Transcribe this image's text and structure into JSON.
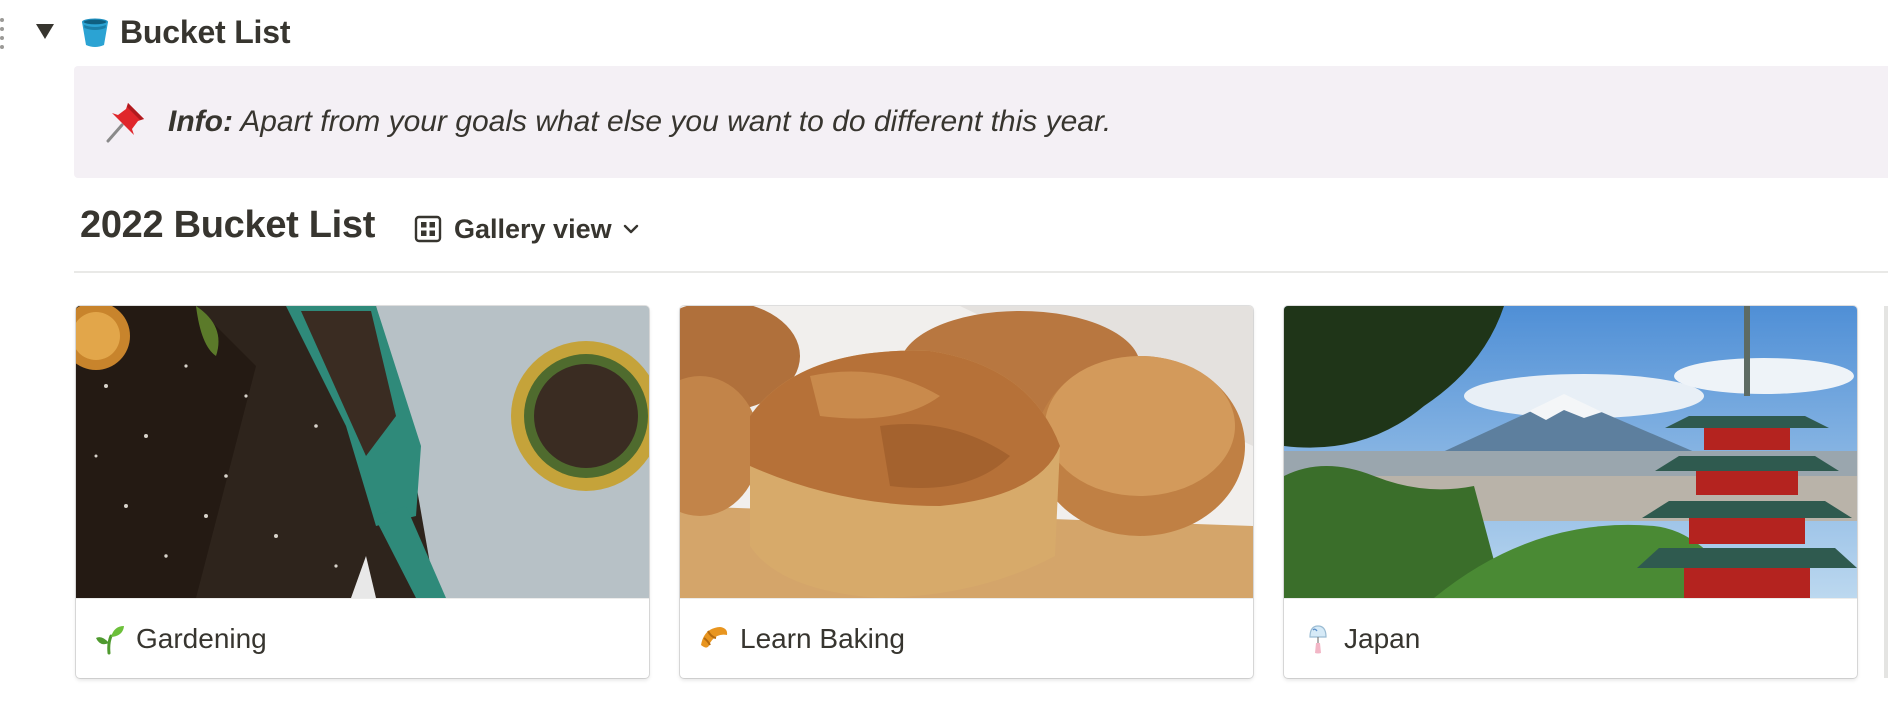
{
  "toggle": {
    "title": "Bucket List",
    "icon": "bucket-icon",
    "expanded": true
  },
  "callout": {
    "icon": "pushpin-icon",
    "label": "Info:",
    "text": " Apart from your goals what else you want to do different this year."
  },
  "database": {
    "title": "2022 Bucket List",
    "view": {
      "icon": "gallery-grid-icon",
      "label": "Gallery view",
      "dropdown_icon": "chevron-down-icon"
    },
    "cards": [
      {
        "title": "Gardening",
        "icon": "seedling-icon",
        "cover": "garden soil, trowel and plant pot"
      },
      {
        "title": "Learn Baking",
        "icon": "croissant-icon",
        "cover": "loaves of bread"
      },
      {
        "title": "Japan",
        "icon": "wind-chime-icon",
        "cover": "Mount Fuji with pagoda"
      }
    ]
  },
  "colors": {
    "text": "#37352f",
    "callout_bg": "#f4f0f5",
    "divider": "#e9e9e7"
  }
}
